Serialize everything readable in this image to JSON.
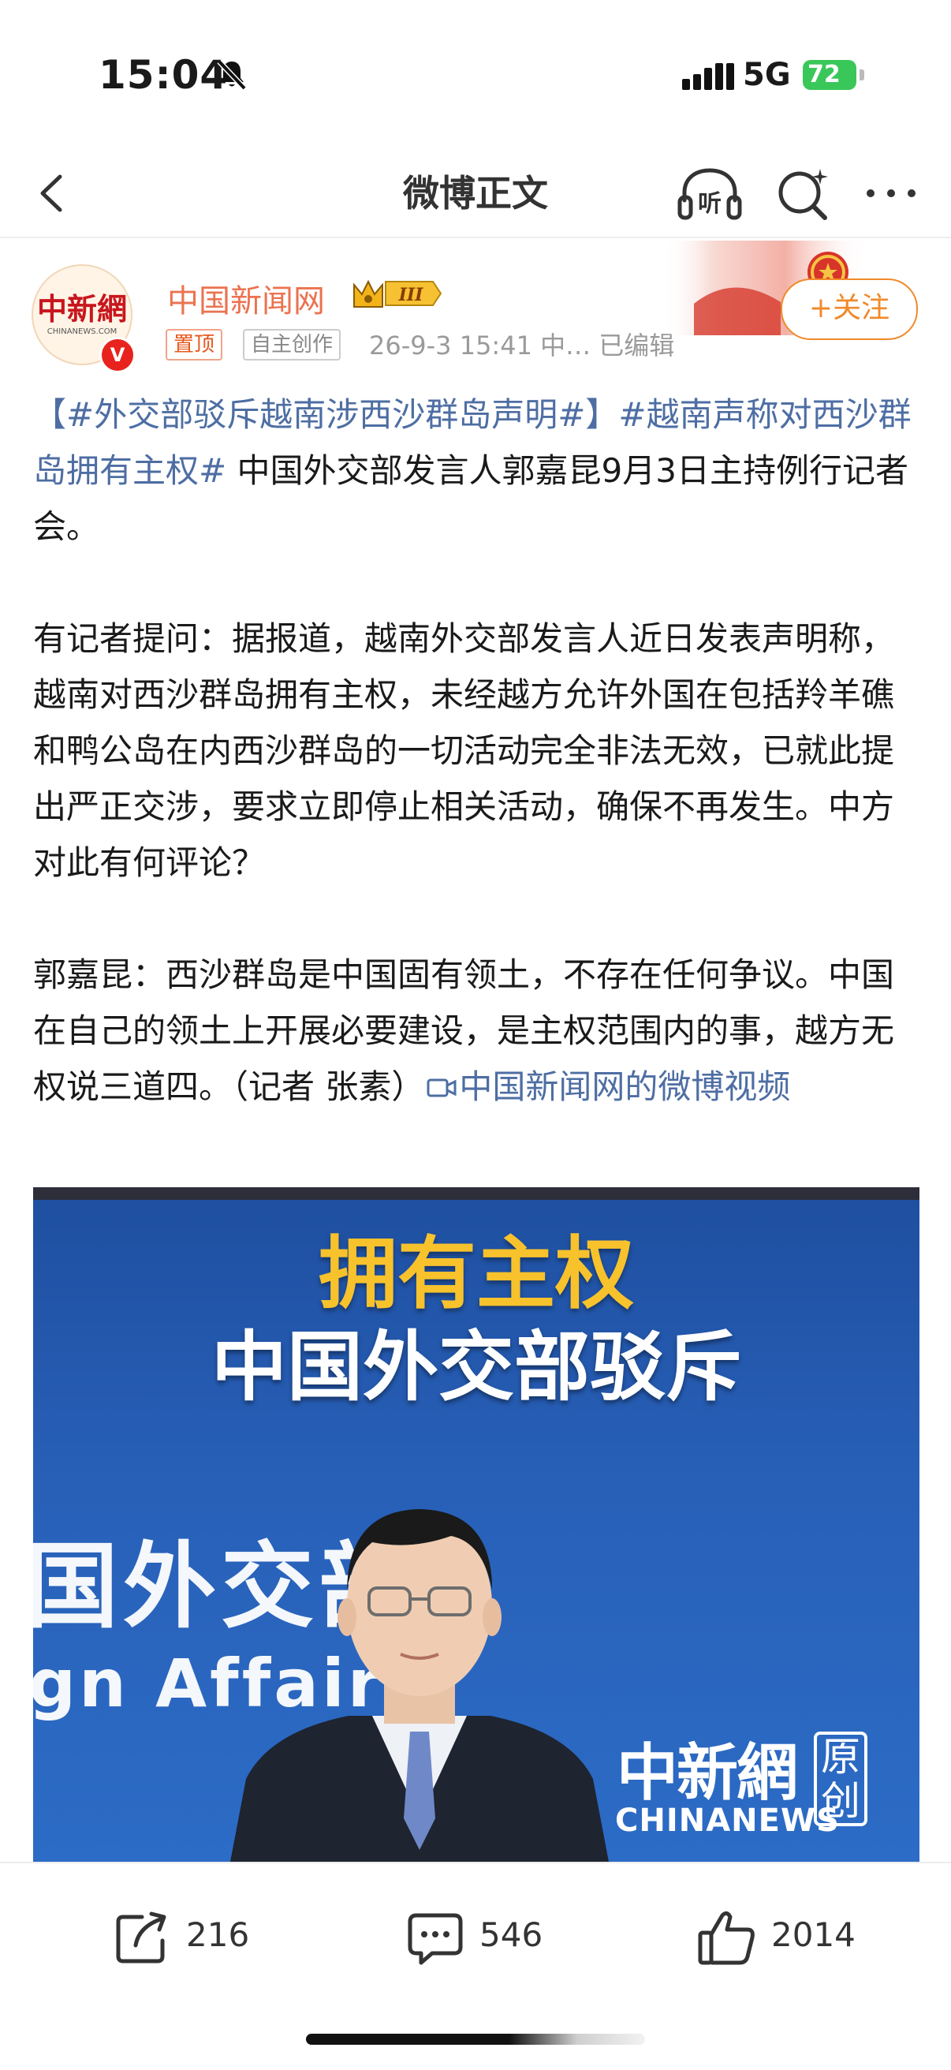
{
  "status_bar": {
    "time": "15:04",
    "network": "5G",
    "battery": "72"
  },
  "nav": {
    "title": "微博正文",
    "icons": [
      "back-arrow-icon",
      "listen-icon",
      "search-icon",
      "more-icon"
    ],
    "listen_label": "听"
  },
  "author": {
    "name": "中国新闻网",
    "avatar_text": "中新網",
    "avatar_subtext": "CHINANEWS.COM",
    "verified_badge": "V",
    "level_badge": "III",
    "tag_pinned": "置顶",
    "tag_original": "自主创作",
    "meta": "26-9-3 15:41  中…  已编辑",
    "follow_label": "+关注"
  },
  "post": {
    "p1_topic1": "【#外交部驳斥越南涉西沙群岛声明#】",
    "p1_topic2": "#越南声称对西沙群岛拥有主权#",
    "p1_text": " 中国外交部发言人郭嘉昆9月3日主持例行记者会。",
    "p2": "有记者提问：据报道，越南外交部发言人近日发表声明称，越南对西沙群岛拥有主权，未经越方允许外国在包括羚羊礁和鸭公岛在内西沙群岛的一切活动完全非法无效，已就此提出严正交涉，要求立即停止相关活动，确保不再发生。中方对此有何评论？",
    "p3_text": "郭嘉昆：西沙群岛是中国固有领土，不存在任何争议。中国在自己的领土上开展必要建设，是主权范围内的事，越方无权说三道四。（记者  张素）",
    "p3_link": "中国新闻网的微博视频"
  },
  "video": {
    "title_line1": "拥有主权",
    "title_line2": "中国外交部驳斥",
    "wall_text1": "国外交部",
    "wall_text2": "gn Affairs",
    "watermark_cn": "中新網",
    "watermark_en": "CHINANEWS",
    "watermark_badge": "原创"
  },
  "actions": {
    "share_count": "216",
    "comment_count": "546",
    "like_count": "2014"
  },
  "colors": {
    "accent_orange": "#eb7350",
    "link_blue": "#4e6ea3",
    "follow_orange": "#f08a2a",
    "battery_green": "#3ac75a",
    "video_blue": "#2860b8",
    "video_title_yellow": "#f7c22c"
  }
}
